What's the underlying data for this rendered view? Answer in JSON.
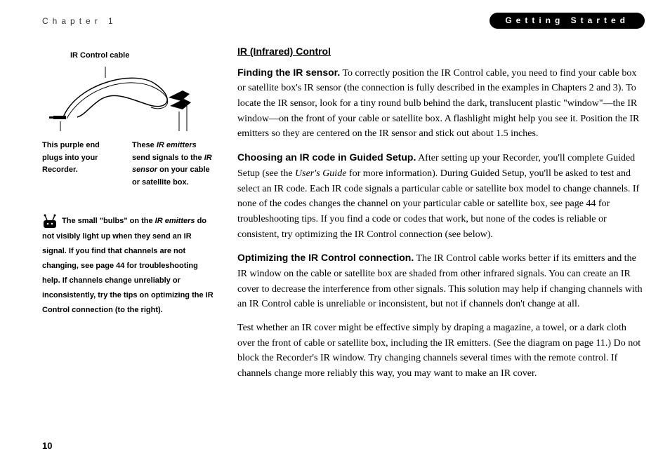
{
  "header": {
    "chapter": "Chapter 1",
    "breadcrumb": "Getting Started"
  },
  "sidebar": {
    "figure": {
      "label_top": "IR Control cable",
      "caption_left_1": "This purple end plugs into your Recorder.",
      "caption_right_prefix": "These ",
      "caption_right_em1": "IR emitters",
      "caption_right_mid": " send signals to the ",
      "caption_right_em2": "IR sensor",
      "caption_right_suffix": " on your cable or satellite box."
    },
    "tip": {
      "prefix": "The small \"bulbs\" on the ",
      "em": "IR emitters",
      "rest": " do not visibly light up when they send an IR signal. If you find that channels are not changing, see page 44 for troubleshooting help. If channels change unreliably or inconsistently, try the tips on optimizing the IR Control connection (to the right)."
    }
  },
  "main": {
    "section_title": "IR (Infrared) Control",
    "p1_lead": "Finding the IR sensor.",
    "p1_body": " To correctly position the IR Control cable, you need to find your cable box or satellite box's IR sensor (the connection is fully described in the examples in Chapters 2 and 3). To locate the IR sensor, look for a tiny round bulb behind the dark, translucent plastic \"window\"—the IR window—on the front of your cable or satellite box. A flashlight might help you see it. Position the IR emitters so they are centered on the IR sensor and stick out about 1.5 inches.",
    "p2_lead": "Choosing an IR code in Guided Setup.",
    "p2_body_a": " After setting up your Recorder, you'll complete Guided Setup (see the ",
    "p2_body_em": "User's Guide",
    "p2_body_b": " for more information). During Guided Setup, you'll be asked to test and select an IR code. Each IR code signals a particular cable or satellite box model to change channels. If none of the codes changes the channel on your particular cable or satellite box, see page 44 for troubleshooting tips. If you find a code or codes that work, but none of the codes is reliable or consistent, try optimizing the IR Control connection (see below).",
    "p3_lead": "Optimizing the IR Control connection.",
    "p3_body": " The IR Control cable works better if its emitters and the IR window on the cable or satellite box are shaded from other infrared signals. You can create an IR cover to decrease the interference from other signals. This solution may help if changing channels with an IR Control cable is unreliable or inconsistent, but not if channels don't change at all.",
    "p4_body": "Test whether an IR cover might be effective simply by draping a magazine, a towel, or a dark cloth over the front of cable or satellite box, including the IR emitters. (See the diagram on page 11.) Do not block the Recorder's IR window. Try changing channels several times with the remote control. If channels change more reliably this way, you may want to make an IR cover."
  },
  "page_number": "10"
}
